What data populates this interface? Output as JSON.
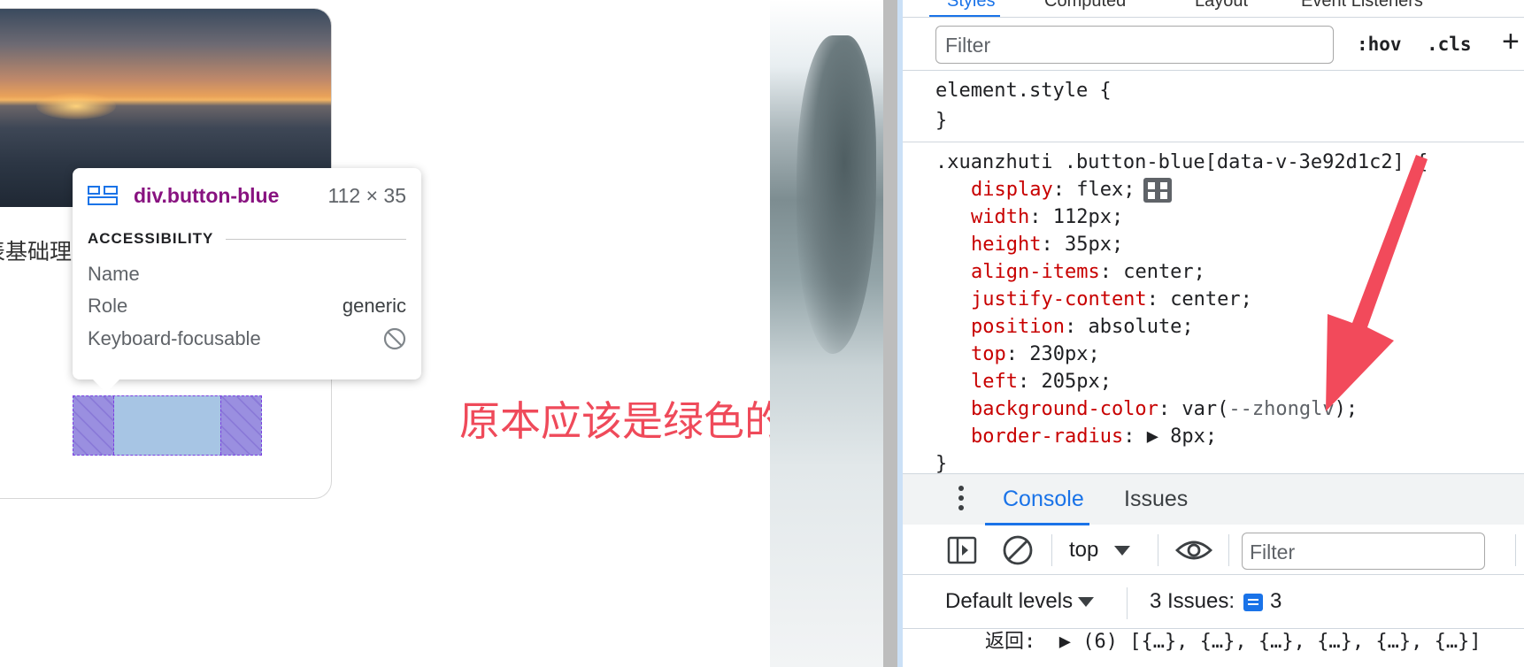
{
  "page": {
    "card_text": "表基础理",
    "annotation": "原本应该是绿色的背景"
  },
  "tooltip": {
    "element_name": "div.button-blue",
    "element_size": "112 × 35",
    "section_title": "ACCESSIBILITY",
    "rows": [
      {
        "label": "Name",
        "value": ""
      },
      {
        "label": "Role",
        "value": "generic"
      },
      {
        "label": "Keyboard-focusable",
        "value": ""
      }
    ]
  },
  "devtools": {
    "tabs": [
      "Styles",
      "Computed",
      "Layout",
      "Event Listeners"
    ],
    "filter_placeholder": "Filter",
    "hov": ":hov",
    "cls": ".cls",
    "plus": "+",
    "element_style_open": "element.style {",
    "element_style_close": "}",
    "selector": ".xuanzhuti .button-blue[data-v-3e92d1c2] {",
    "properties": [
      {
        "name": "display",
        "value": "flex;"
      },
      {
        "name": "width",
        "value": "112px;"
      },
      {
        "name": "height",
        "value": "35px;"
      },
      {
        "name": "align-items",
        "value": "center;"
      },
      {
        "name": "justify-content",
        "value": "center;"
      },
      {
        "name": "position",
        "value": "absolute;"
      },
      {
        "name": "top",
        "value": "230px;"
      },
      {
        "name": "left",
        "value": "205px;"
      },
      {
        "name": "background-color",
        "value_prefix": "var(",
        "value_var": "--zhonglv",
        "value_suffix": ");"
      },
      {
        "name": "border-radius",
        "value": "▶ 8px;"
      }
    ],
    "rule_close": "}",
    "drawer_tabs": [
      "Console",
      "Issues"
    ],
    "context": "top",
    "console_filter_placeholder": "Filter",
    "levels": "Default levels",
    "issues_label": "3 Issues:",
    "issues_count": "3",
    "log_line": "返回:  ▶ (6) [{…}, {…}, {…}, {…}, {…}, {…}]"
  },
  "colors": {
    "accent": "#1a73e8",
    "css_property": "#c80000",
    "annotation": "#ef4a5a",
    "element_tag": "#881280",
    "overlay_content": "#a7c5e4",
    "overlay_padding": "#9a8fe0"
  }
}
